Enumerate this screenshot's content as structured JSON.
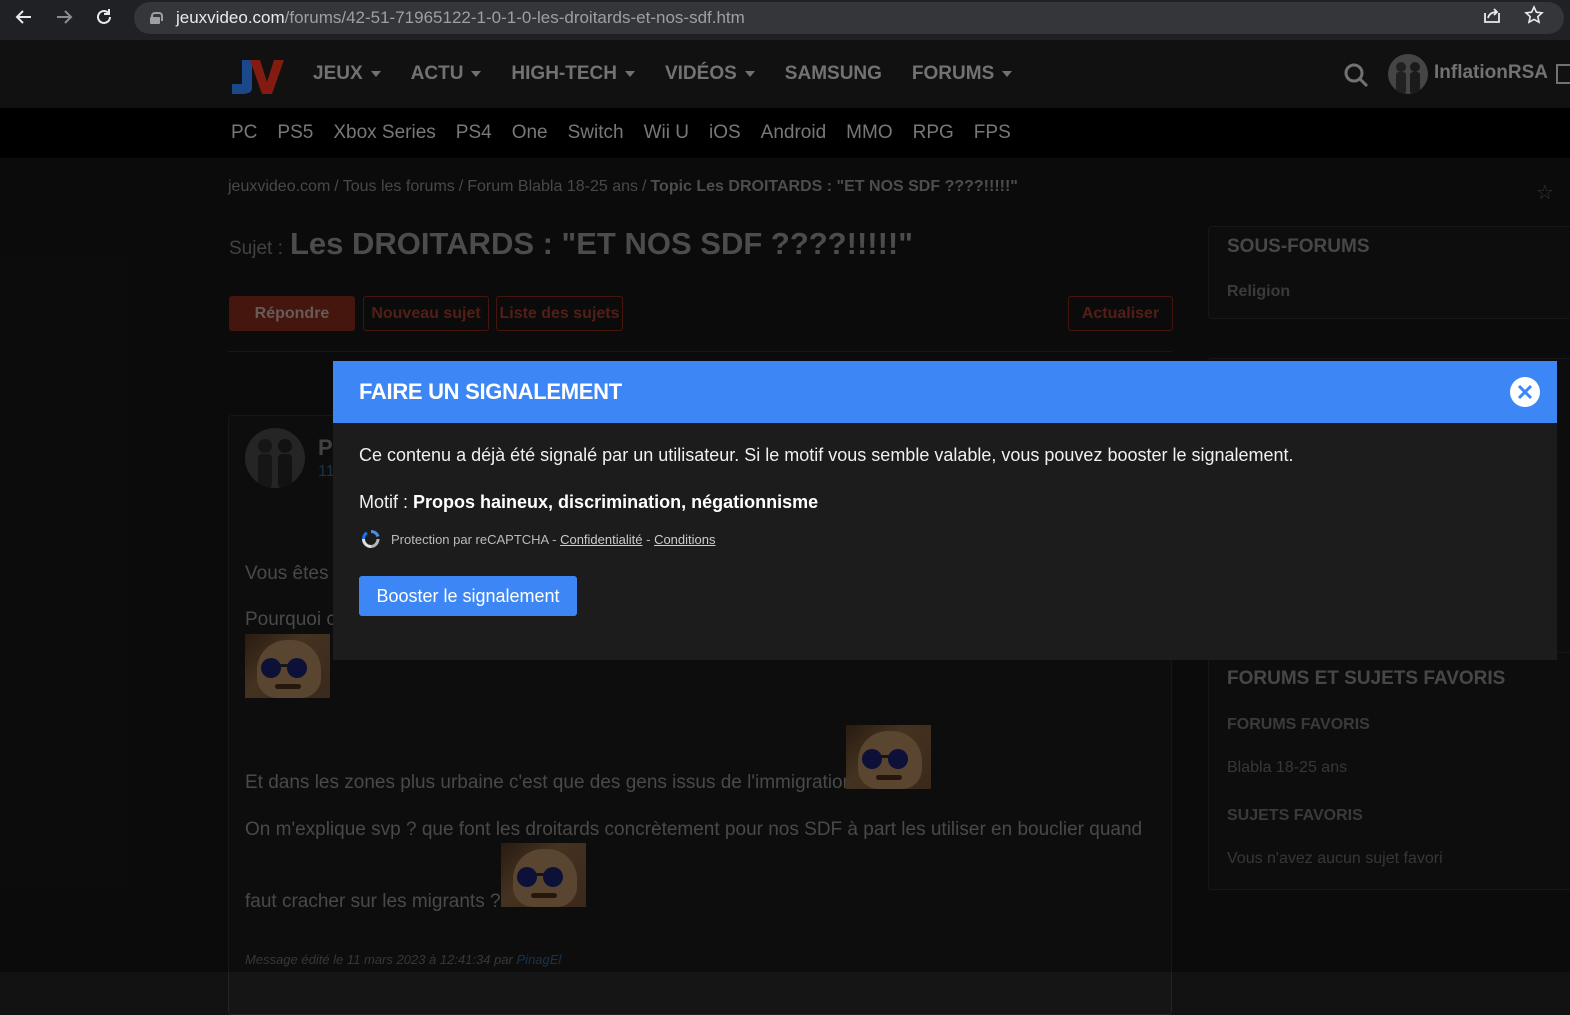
{
  "browser": {
    "url_domain": "jeuxvideo.com",
    "url_path": "/forums/42-51-71965122-1-0-1-0-les-droitards-et-nos-sdf.htm"
  },
  "header": {
    "nav": [
      {
        "label": "JEUX"
      },
      {
        "label": "ACTU"
      },
      {
        "label": "HIGH-TECH"
      },
      {
        "label": "VIDÉOS"
      },
      {
        "label": "SAMSUNG"
      },
      {
        "label": "FORUMS"
      }
    ],
    "username": "InflationRSA"
  },
  "platforms": [
    "PC",
    "PS5",
    "Xbox Series",
    "PS4",
    "One",
    "Switch",
    "Wii U",
    "iOS",
    "Android",
    "MMO",
    "RPG",
    "FPS"
  ],
  "breadcrumb": {
    "site": "jeuxvideo.com",
    "all_forums": "Tous les forums",
    "forum": "Forum Blabla 18-25 ans",
    "topic": "Topic Les DROITARDS : \"ET NOS SDF ????!!!!!\""
  },
  "subject": {
    "prefix": "Sujet :",
    "title": "Les DROITARDS : \"ET NOS SDF ????!!!!!\""
  },
  "actions": {
    "reply": "Répondre",
    "new_topic": "Nouveau sujet",
    "topic_list": "Liste des sujets",
    "refresh": "Actualiser"
  },
  "post": {
    "author_partial": "Pi",
    "date_partial": "11",
    "line1_partial": "Vous êtes d",
    "line2_partial": "Pourquoi c",
    "line3": "Et dans les zones plus urbaine c'est que des gens issus de l'immigration",
    "line4": "On m'explique svp ? que font les droitards concrètement pour nos SDF à part les utiliser en bouclier quand",
    "line5": "faut cracher sur les migrants ?",
    "edited_prefix": "Message édité le 11 mars 2023 à 12:41:34 par",
    "edited_by": "PinagEl"
  },
  "sidebar": {
    "subforums_title": "SOUS-FORUMS",
    "subforum_1": "Religion",
    "favorites_title": "FORUMS ET SUJETS FAVORIS",
    "fav_forums_title": "FORUMS FAVORIS",
    "fav_forum_1": "Blabla 18-25 ans",
    "fav_topics_title": "SUJETS FAVORIS",
    "fav_topics_empty": "Vous n'avez aucun sujet favori"
  },
  "modal": {
    "title": "FAIRE UN SIGNALEMENT",
    "message": "Ce contenu a déjà été signalé par un utilisateur. Si le motif vous semble valable, vous pouvez booster le signalement.",
    "motif_label": "Motif :",
    "motif_value": "Propos haineux, discrimination, négationnisme",
    "recaptcha_text": "Protection par reCAPTCHA -",
    "privacy": "Confidentialité",
    "dash": "-",
    "terms": "Conditions",
    "boost_button": "Booster le signalement"
  },
  "colors": {
    "modal_accent": "#3c87f5",
    "brand_red": "#c92a1a",
    "brand_blue": "#2a6fd6"
  }
}
